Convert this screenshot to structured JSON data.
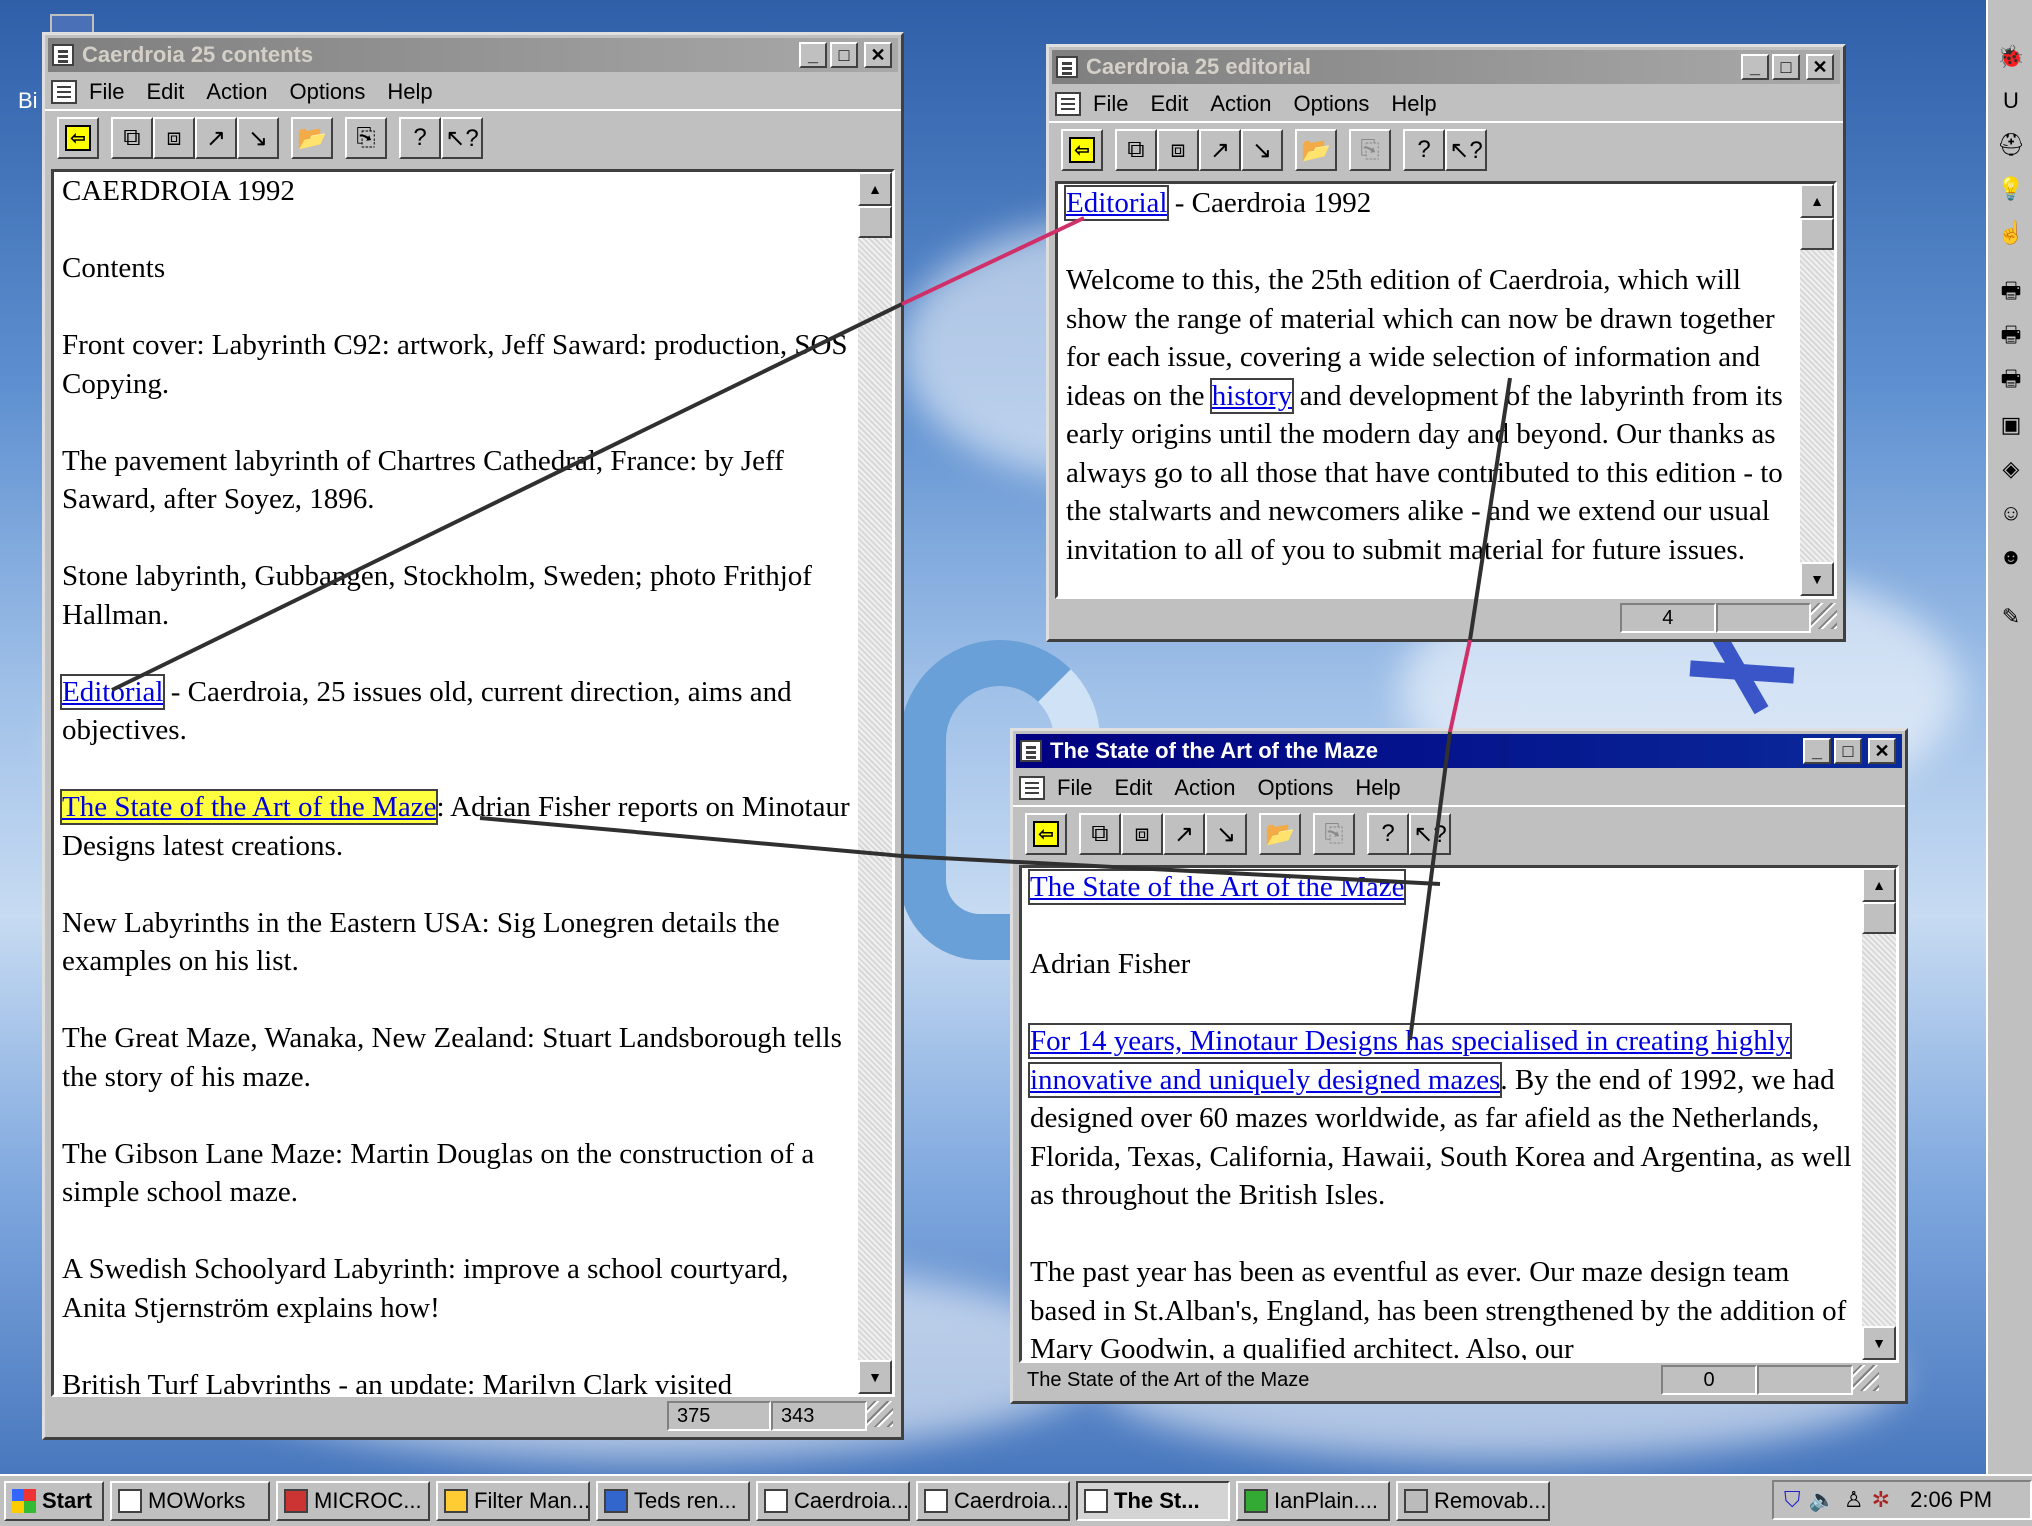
{
  "colors": {
    "title_active": "#000080",
    "title_inactive": "#808080",
    "link": "#0000e0",
    "highlight": "#ffff40",
    "line_red": "#d0306a"
  },
  "menu": [
    "File",
    "Edit",
    "Action",
    "Options",
    "Help"
  ],
  "desktop": {
    "icon_label": "Bi"
  },
  "windows": {
    "contents": {
      "title": "Caerdroia 25 contents",
      "heading": "CAERDROIA 1992",
      "subheading": "Contents",
      "p_front": "Front cover: Labyrinth C92: artwork, Jeff Saward: production, SOS Copying.",
      "p_chartres": "The pavement labyrinth of Chartres Cathedral, France: by Jeff Saward, after Soyez, 1896.",
      "p_stone": "Stone labyrinth, Gubbangen, Stockholm, Sweden; photo Frithjof Hallman.",
      "editorial_link": "Editorial",
      "editorial_rest": " - Caerdroia, 25 issues old, current direction, aims and objectives.",
      "state_link": "The State of the Art of the Maze",
      "state_rest": ": Adrian Fisher reports on Minotaur Designs latest creations.",
      "p_newlab": "New Labyrinths in the Eastern USA: Sig Lonegren details the examples on his list.",
      "p_great": "The Great Maze, Wanaka, New Zealand: Stuart Landsborough tells the story of his maze.",
      "p_gibson": "The Gibson Lane Maze: Martin Douglas on the construction of a simple school maze.",
      "p_swedish": "A Swedish Schoolyard Labyrinth: improve a school courtyard, Anita Stjernström explains how!",
      "p_british": "British Turf Labyrinths - an update: Marilyn Clark visited",
      "status_a": "375",
      "status_b": "343"
    },
    "editorial": {
      "title": "Caerdroia 25 editorial",
      "heading_link": "Editorial",
      "heading_rest": " - Caerdroia 1992",
      "body_a": "Welcome to this, the 25th edition of Caerdroia, which will show the range of material which can now be drawn together for each issue, covering a wide selection of information and ideas on the ",
      "history_link": "history",
      "body_b": " and development of the labyrinth from its early origins until the modern day and beyond. Our thanks as always go to all those that have contributed to this edition - to the stalwarts and newcomers alike - and we extend our usual invitation to all of you to submit material for future issues.",
      "status_num": "4"
    },
    "state": {
      "title": "The State of the Art of the Maze",
      "heading_link": "The State of the Art of the Maze",
      "author": "Adrian Fisher",
      "link_text": "For 14 years, Minotaur Designs has specialised in creating highly innovative and uniquely designed mazes",
      "body_a": ". By the end of 1992, we had designed over 60 mazes worldwide, as far afield as the Netherlands, Florida, Texas, California, Hawaii, South Korea and Argentina, as well as throughout the British Isles.",
      "body_b": "The past year has been as eventful as ever. Our maze design team based in St.Alban's, England, has been strengthened by the addition of Mary Goodwin, a qualified architect. Also, our",
      "status_text": "The State of the Art of the Maze",
      "status_num": "0"
    }
  },
  "taskbar": {
    "start": "Start",
    "items": [
      "MOWorks",
      "MICROC...",
      "Filter Man...",
      "Teds ren...",
      "Caerdroia...",
      "Caerdroia...",
      "The St...",
      "IanPlain....",
      "Removab..."
    ],
    "active_index": 6,
    "clock": "2:06 PM"
  },
  "icons": {
    "right_toolbar": [
      "bug-icon",
      "magnet-icon",
      "hat-icon",
      "bulb-icon",
      "hand-icon",
      "printer-icon",
      "printer-icon",
      "printer-icon",
      "frame-icon",
      "brain-icon",
      "face-icon",
      "face-icon",
      "pencil-icon"
    ],
    "toolbar": [
      "go-back-icon",
      "copy-icon",
      "paste-icon",
      "link-out-icon",
      "link-in-icon",
      "open-folder-icon",
      "copy-page-icon",
      "help-icon",
      "context-help-icon"
    ]
  }
}
